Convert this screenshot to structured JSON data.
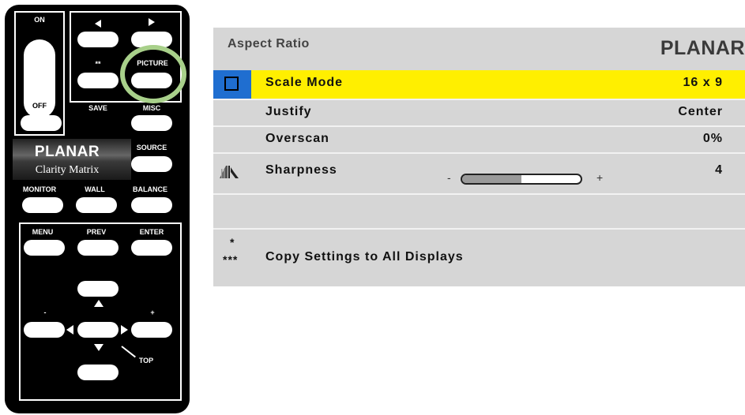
{
  "remote": {
    "labels": {
      "on": "ON",
      "off": "OFF",
      "star": "**",
      "picture": "PICTURE",
      "save": "SAVE",
      "misc": "MISC",
      "source": "SOURCE",
      "monitor": "MONITOR",
      "wall": "WALL",
      "balance": "BALANCE",
      "menu": "MENU",
      "prev": "PREV",
      "enter": "ENTER",
      "minus": "-",
      "plus": "+",
      "top": "TOP"
    },
    "brand": {
      "name": "PLANAR",
      "subtitle": "Clarity Matrix"
    },
    "highlight_color": "#a8d08a"
  },
  "osd": {
    "title": "Aspect Ratio",
    "logo": "PLANAR",
    "selected_row_color": "#ffef00",
    "rows": [
      {
        "label": "Scale Mode",
        "value": "16 x 9",
        "icon": "aspect-square-icon",
        "selected": true
      },
      {
        "label": "Justify",
        "value": "Center"
      },
      {
        "label": "Overscan",
        "value": "0%"
      },
      {
        "label": "Sharpness",
        "value": "4",
        "icon": "sharpness-icon",
        "slider": {
          "minus": "-",
          "plus": "+",
          "level_percent": 50
        }
      }
    ],
    "copy": {
      "stars_top": "*",
      "stars_bottom": "***",
      "label": "Copy Settings to All Displays"
    }
  }
}
